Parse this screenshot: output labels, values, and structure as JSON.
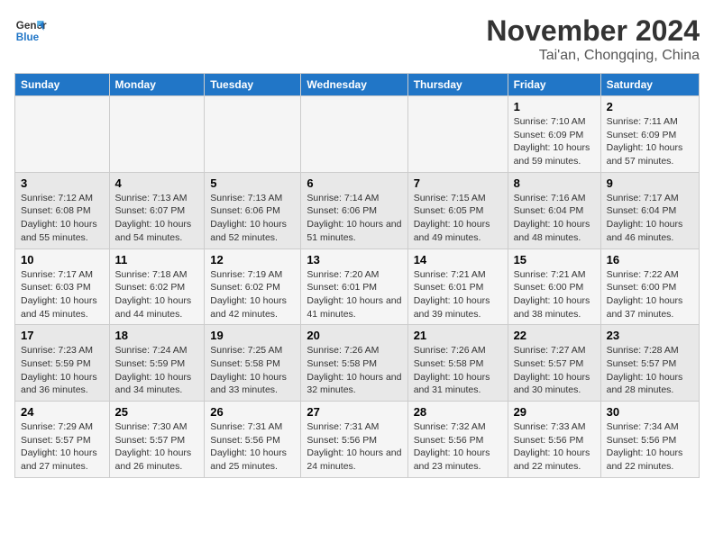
{
  "logo": {
    "line1": "General",
    "line2": "Blue"
  },
  "title": "November 2024",
  "subtitle": "Tai'an, Chongqing, China",
  "weekdays": [
    "Sunday",
    "Monday",
    "Tuesday",
    "Wednesday",
    "Thursday",
    "Friday",
    "Saturday"
  ],
  "weeks": [
    [
      {
        "day": "",
        "info": ""
      },
      {
        "day": "",
        "info": ""
      },
      {
        "day": "",
        "info": ""
      },
      {
        "day": "",
        "info": ""
      },
      {
        "day": "",
        "info": ""
      },
      {
        "day": "1",
        "info": "Sunrise: 7:10 AM\nSunset: 6:09 PM\nDaylight: 10 hours and 59 minutes."
      },
      {
        "day": "2",
        "info": "Sunrise: 7:11 AM\nSunset: 6:09 PM\nDaylight: 10 hours and 57 minutes."
      }
    ],
    [
      {
        "day": "3",
        "info": "Sunrise: 7:12 AM\nSunset: 6:08 PM\nDaylight: 10 hours and 55 minutes."
      },
      {
        "day": "4",
        "info": "Sunrise: 7:13 AM\nSunset: 6:07 PM\nDaylight: 10 hours and 54 minutes."
      },
      {
        "day": "5",
        "info": "Sunrise: 7:13 AM\nSunset: 6:06 PM\nDaylight: 10 hours and 52 minutes."
      },
      {
        "day": "6",
        "info": "Sunrise: 7:14 AM\nSunset: 6:06 PM\nDaylight: 10 hours and 51 minutes."
      },
      {
        "day": "7",
        "info": "Sunrise: 7:15 AM\nSunset: 6:05 PM\nDaylight: 10 hours and 49 minutes."
      },
      {
        "day": "8",
        "info": "Sunrise: 7:16 AM\nSunset: 6:04 PM\nDaylight: 10 hours and 48 minutes."
      },
      {
        "day": "9",
        "info": "Sunrise: 7:17 AM\nSunset: 6:04 PM\nDaylight: 10 hours and 46 minutes."
      }
    ],
    [
      {
        "day": "10",
        "info": "Sunrise: 7:17 AM\nSunset: 6:03 PM\nDaylight: 10 hours and 45 minutes."
      },
      {
        "day": "11",
        "info": "Sunrise: 7:18 AM\nSunset: 6:02 PM\nDaylight: 10 hours and 44 minutes."
      },
      {
        "day": "12",
        "info": "Sunrise: 7:19 AM\nSunset: 6:02 PM\nDaylight: 10 hours and 42 minutes."
      },
      {
        "day": "13",
        "info": "Sunrise: 7:20 AM\nSunset: 6:01 PM\nDaylight: 10 hours and 41 minutes."
      },
      {
        "day": "14",
        "info": "Sunrise: 7:21 AM\nSunset: 6:01 PM\nDaylight: 10 hours and 39 minutes."
      },
      {
        "day": "15",
        "info": "Sunrise: 7:21 AM\nSunset: 6:00 PM\nDaylight: 10 hours and 38 minutes."
      },
      {
        "day": "16",
        "info": "Sunrise: 7:22 AM\nSunset: 6:00 PM\nDaylight: 10 hours and 37 minutes."
      }
    ],
    [
      {
        "day": "17",
        "info": "Sunrise: 7:23 AM\nSunset: 5:59 PM\nDaylight: 10 hours and 36 minutes."
      },
      {
        "day": "18",
        "info": "Sunrise: 7:24 AM\nSunset: 5:59 PM\nDaylight: 10 hours and 34 minutes."
      },
      {
        "day": "19",
        "info": "Sunrise: 7:25 AM\nSunset: 5:58 PM\nDaylight: 10 hours and 33 minutes."
      },
      {
        "day": "20",
        "info": "Sunrise: 7:26 AM\nSunset: 5:58 PM\nDaylight: 10 hours and 32 minutes."
      },
      {
        "day": "21",
        "info": "Sunrise: 7:26 AM\nSunset: 5:58 PM\nDaylight: 10 hours and 31 minutes."
      },
      {
        "day": "22",
        "info": "Sunrise: 7:27 AM\nSunset: 5:57 PM\nDaylight: 10 hours and 30 minutes."
      },
      {
        "day": "23",
        "info": "Sunrise: 7:28 AM\nSunset: 5:57 PM\nDaylight: 10 hours and 28 minutes."
      }
    ],
    [
      {
        "day": "24",
        "info": "Sunrise: 7:29 AM\nSunset: 5:57 PM\nDaylight: 10 hours and 27 minutes."
      },
      {
        "day": "25",
        "info": "Sunrise: 7:30 AM\nSunset: 5:57 PM\nDaylight: 10 hours and 26 minutes."
      },
      {
        "day": "26",
        "info": "Sunrise: 7:31 AM\nSunset: 5:56 PM\nDaylight: 10 hours and 25 minutes."
      },
      {
        "day": "27",
        "info": "Sunrise: 7:31 AM\nSunset: 5:56 PM\nDaylight: 10 hours and 24 minutes."
      },
      {
        "day": "28",
        "info": "Sunrise: 7:32 AM\nSunset: 5:56 PM\nDaylight: 10 hours and 23 minutes."
      },
      {
        "day": "29",
        "info": "Sunrise: 7:33 AM\nSunset: 5:56 PM\nDaylight: 10 hours and 22 minutes."
      },
      {
        "day": "30",
        "info": "Sunrise: 7:34 AM\nSunset: 5:56 PM\nDaylight: 10 hours and 22 minutes."
      }
    ]
  ]
}
